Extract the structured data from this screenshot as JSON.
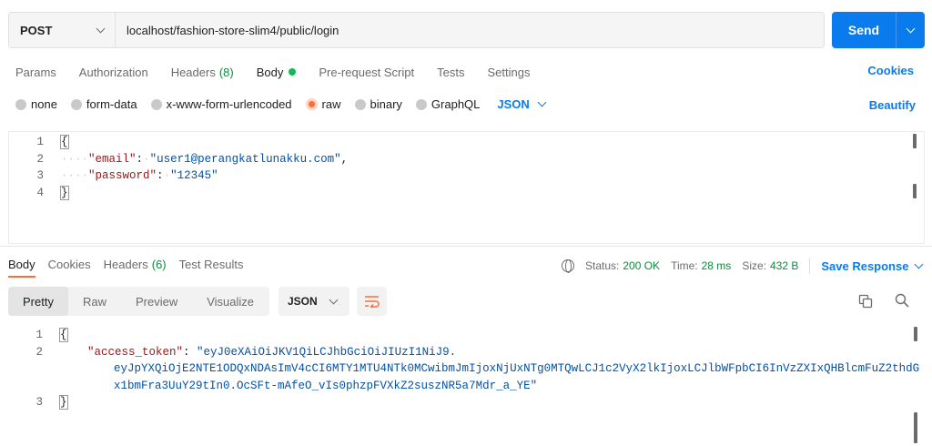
{
  "request": {
    "method": "POST",
    "url": "localhost/fashion-store-slim4/public/login",
    "send_label": "Send"
  },
  "tabs": [
    {
      "label": "Params"
    },
    {
      "label": "Authorization"
    },
    {
      "label": "Headers",
      "count": "(8)"
    },
    {
      "label": "Body"
    },
    {
      "label": "Pre-request Script"
    },
    {
      "label": "Tests"
    },
    {
      "label": "Settings"
    }
  ],
  "cookies_label": "Cookies",
  "body_types": [
    "none",
    "form-data",
    "x-www-form-urlencoded",
    "raw",
    "binary",
    "GraphQL"
  ],
  "body_format": "JSON",
  "beautify_label": "Beautify",
  "request_body": {
    "line_numbers": [
      "1",
      "2",
      "3",
      "4"
    ],
    "open": "{",
    "email_key": "\"email\"",
    "email_value": "\"user1@perangkatlunakku.com\"",
    "password_key": "\"password\"",
    "password_value": "\"12345\"",
    "close": "}"
  },
  "response_tabs": [
    {
      "label": "Body"
    },
    {
      "label": "Cookies"
    },
    {
      "label": "Headers",
      "count": "(6)"
    },
    {
      "label": "Test Results"
    }
  ],
  "status": {
    "status_label": "Status:",
    "status_value": "200 OK",
    "time_label": "Time:",
    "time_value": "28 ms",
    "size_label": "Size:",
    "size_value": "432 B"
  },
  "save_response_label": "Save Response",
  "view_modes": [
    "Pretty",
    "Raw",
    "Preview",
    "Visualize"
  ],
  "response_format": "JSON",
  "response_body": {
    "line_numbers": [
      "1",
      "2",
      "3"
    ],
    "open": "{",
    "token_key": "\"access_token\"",
    "token_line1": "\"eyJ0eXAiOiJKV1QiLCJhbGciOiJIUzI1NiJ9.",
    "token_line2": "eyJpYXQiOjE2NTE1ODQxNDAsImV4cCI6MTY1MTU4NTk0MCwibmJmIjoxNjUxNTg0MTQwLCJ1c2VyX2lkIjoxLCJlbWFpbCI6InVzZXIxQHBlcmFuZ2thdG",
    "token_line3": "x1bmFra3UuY29tIn0.OcSFt-mAfeO_vIs0phzpFVXkZ2suszNR5a7Mdr_a_YE\"",
    "close": "}"
  }
}
